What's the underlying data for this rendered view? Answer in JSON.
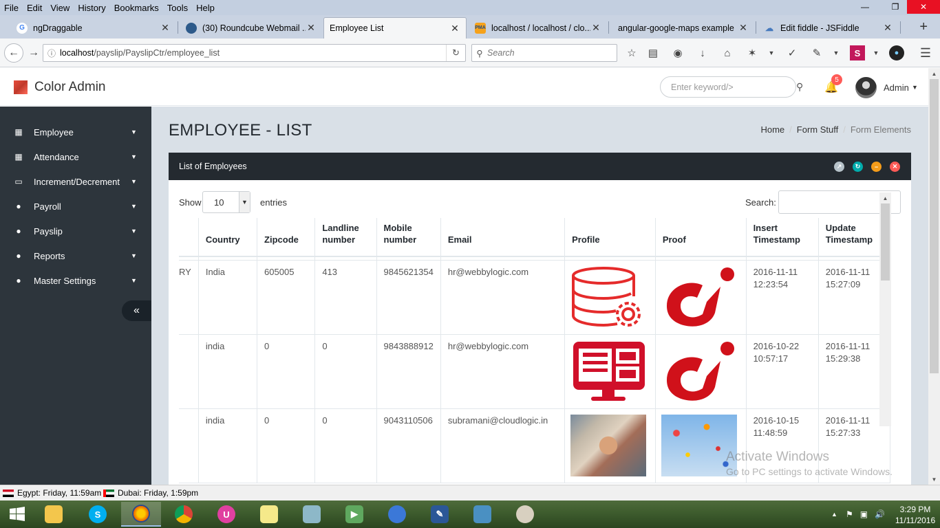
{
  "browser": {
    "menu": [
      "File",
      "Edit",
      "View",
      "History",
      "Bookmarks",
      "Tools",
      "Help"
    ],
    "tabs": [
      {
        "title": "ngDraggable",
        "icon": "google-icon"
      },
      {
        "title": "(30) Roundcube Webmail ...",
        "icon": "roundcube-icon"
      },
      {
        "title": "Employee List",
        "icon": "none",
        "active": true
      },
      {
        "title": "localhost / localhost / clo...",
        "icon": "phpmyadmin-icon"
      },
      {
        "title": "angular-google-maps example",
        "icon": "none"
      },
      {
        "title": "Edit fiddle - JSFiddle",
        "icon": "jsfiddle-icon"
      }
    ],
    "url_host": "localhost",
    "url_path": "/payslip/PayslipCtr/employee_list",
    "search_placeholder": "Search"
  },
  "app": {
    "brand": "Color Admin",
    "keyword_placeholder": "Enter keyword/>",
    "notification_count": "5",
    "user": "Admin"
  },
  "sidebar": {
    "items": [
      {
        "label": "Employee",
        "icon": "building-icon"
      },
      {
        "label": "Attendance",
        "icon": "building-icon"
      },
      {
        "label": "Increment/Decrement",
        "icon": "laptop-icon"
      },
      {
        "label": "Payroll",
        "icon": "user-icon"
      },
      {
        "label": "Payslip",
        "icon": "user-icon"
      },
      {
        "label": "Reports",
        "icon": "user-icon"
      },
      {
        "label": "Master Settings",
        "icon": "user-icon"
      }
    ],
    "collapse_label": "«"
  },
  "page": {
    "title": "EMPLOYEE - LIST",
    "breadcrumb": [
      "Home",
      "Form Stuff",
      "Form Elements"
    ]
  },
  "panel": {
    "title": "List of Employees",
    "show_label": "Show",
    "length_value": "10",
    "entries_label": "entries",
    "search_label": "Search:"
  },
  "table": {
    "headers": [
      "",
      "Country",
      "Zipcode",
      "Landline number",
      "Mobile number",
      "Email",
      "Profile",
      "Proof",
      "Insert Timestamp",
      "Update Timestamp"
    ],
    "rows": [
      {
        "partial": "RY",
        "country": "India",
        "zipcode": "605005",
        "landline": "413",
        "mobile": "9845621354",
        "email": "hr@webbylogic.com",
        "profile": "database-gear-image",
        "proof": "dj-logo-image",
        "insert_date": "2016-11-11",
        "insert_time": "12:23:54",
        "update_date": "2016-11-11",
        "update_time": "15:27:09"
      },
      {
        "partial": "",
        "country": "india",
        "zipcode": "0",
        "landline": "0",
        "mobile": "9843888912",
        "email": "hr@webbylogic.com",
        "profile": "monitor-dashboard-image",
        "proof": "dj-logo-image",
        "insert_date": "2016-10-22",
        "insert_time": "10:57:17",
        "update_date": "2016-11-11",
        "update_time": "15:29:38"
      },
      {
        "partial": "",
        "country": "india",
        "zipcode": "0",
        "landline": "0",
        "mobile": "9043110506",
        "email": "subramani@cloudlogic.in",
        "profile": "team-hands-photo",
        "proof": "hot-air-balloons-photo",
        "insert_date": "2016-10-15",
        "insert_time": "11:48:59",
        "update_date": "2016-11-11",
        "update_time": "15:27:33"
      }
    ]
  },
  "watermark": {
    "line1": "Activate Windows",
    "line2": "Go to PC settings to activate Windows."
  },
  "clocks": [
    {
      "label": "Egypt: Friday, 11:59am"
    },
    {
      "label": "Dubai: Friday, 1:59pm"
    }
  ],
  "taskbar": {
    "time": "3:29 PM",
    "date": "11/11/2016"
  },
  "colors": {
    "sidebar_bg": "#2d353c",
    "content_bg": "#d9e0e7",
    "panel_header": "#242a30",
    "icon_red": "#e52b2b"
  }
}
